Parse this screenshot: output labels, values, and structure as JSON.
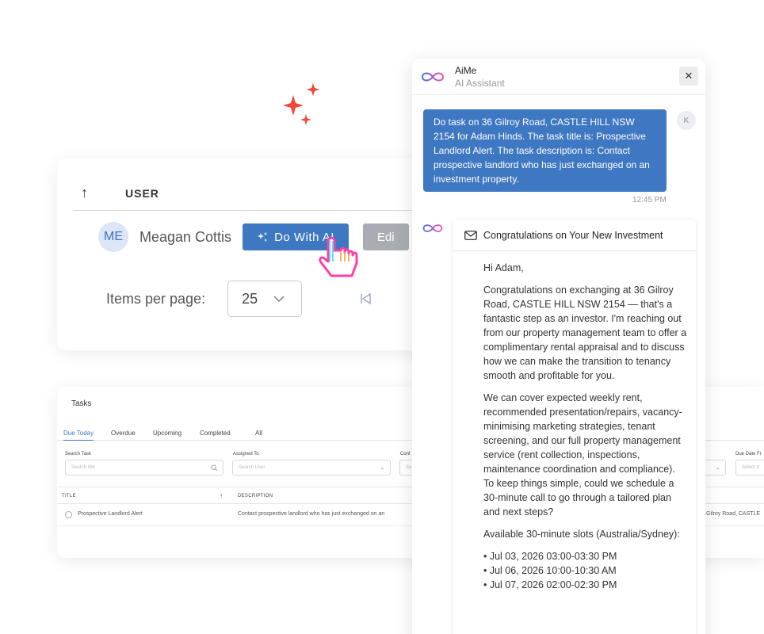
{
  "user_card": {
    "column_header": "USER",
    "avatar_initials": "ME",
    "user_name": "Meagan Cottis",
    "do_with_ai_label": "Do With AI",
    "edit_label": "Edi",
    "items_per_page_label": "Items per page:",
    "items_per_page_value": "25"
  },
  "tasks": {
    "title": "Tasks",
    "tabs": [
      "Due Today",
      "Overdue",
      "Upcoming",
      "Completed",
      "All"
    ],
    "active_tab": "Due Today",
    "filters": {
      "search_task_label": "Search Task",
      "search_task_placeholder": "Search title",
      "assigned_to_label": "Assigned To",
      "assigned_to_placeholder": "Search User",
      "contact_label_partial": "Cont",
      "contact_placeholder_partial": "Se",
      "due_date_label_partial": "Due Date Fr",
      "due_date_placeholder_partial": "Select d"
    },
    "columns": [
      "TITLE",
      "DESCRIPTION"
    ],
    "rows": [
      {
        "title": "Prospective Landlord Alert",
        "description": "Contact prospective landlord who has just exchanged on an",
        "address_partial": "Gilroy Road, CASTLE"
      }
    ]
  },
  "chat": {
    "assistant_name": "AiMe",
    "assistant_subtitle": "AI Assistant",
    "user_avatar": "K",
    "user_message": "Do task on 36 Gilroy Road, CASTLE HILL NSW 2154 for Adam Hinds. The task title is: Prospective Landlord Alert. The task description is: Contact prospective landlord who has just exchanged on an investment property.",
    "user_message_time": "12:45 PM",
    "email": {
      "subject": "Congratulations on Your New Investment",
      "greeting": "Hi Adam,",
      "paragraph_1": "Congratulations on exchanging at 36 Gilroy Road, CASTLE HILL NSW 2154 — that's a fantastic step as an investor. I'm reaching out from our property management team to offer a complimentary rental appraisal and to discuss how we can make the transition to tenancy smooth and profitable for you.",
      "paragraph_2": "We can cover expected weekly rent, recommended presentation/repairs, vacancy-minimising marketing strategies, tenant screening, and our full property management service (rent collection, inspections, maintenance coordination and compliance). To keep things simple, could we schedule a 30-minute call to go through a tailored plan and next steps?",
      "slots_intro": "Available 30-minute slots (Australia/Sydney):",
      "slots": [
        "• Jul 03, 2026 03:00-03:30 PM",
        "• Jul 06, 2026 10:00-10:30 AM",
        "• Jul 07, 2026 02:00-02:30 PM"
      ]
    }
  },
  "colors": {
    "primary_blue": "#3f78c2",
    "sparkle_red": "#f0473a",
    "disabled_gray": "#a9acb2"
  },
  "icons": [
    "sparkle-icon",
    "arrow-up-icon",
    "ai-sparkle-icon",
    "hand-pointer-icon",
    "chevron-down-icon",
    "first-page-icon",
    "search-icon",
    "infinity-logo-icon",
    "close-icon",
    "mail-icon"
  ]
}
